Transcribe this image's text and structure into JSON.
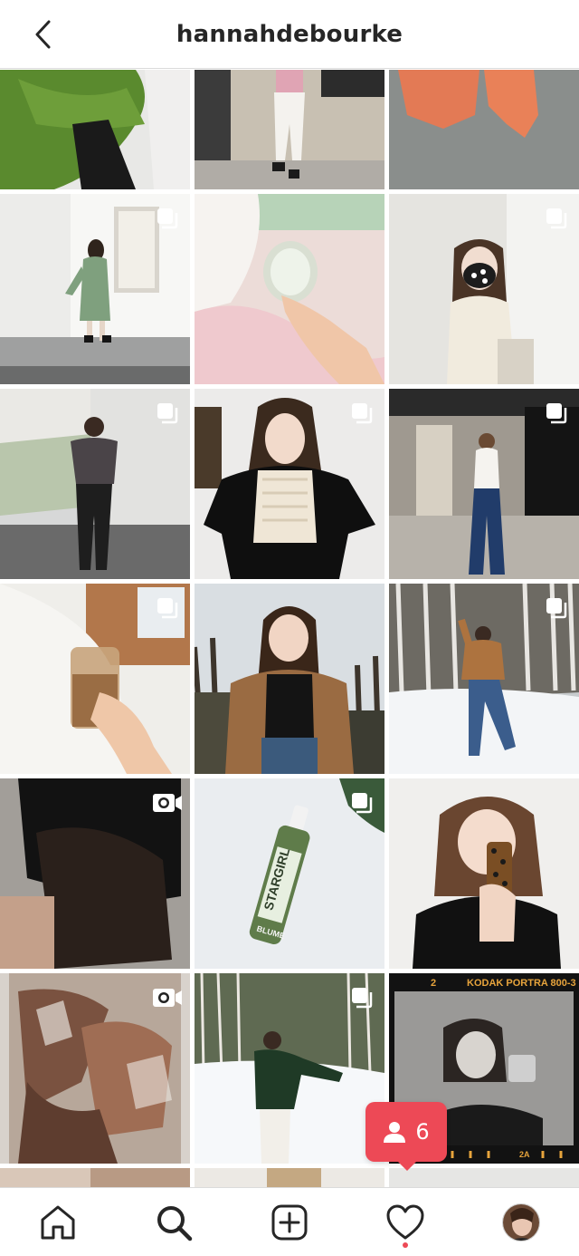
{
  "header": {
    "username": "hannahdebourke"
  },
  "grid": {
    "rows": [
      [
        "green-knit-photo",
        "walking-white-jeans-photo",
        "orange-swimsuits-photo"
      ],
      [
        "green-sweater-dress-photo",
        "jar-on-blanket-photo",
        "face-mask-photo"
      ],
      [
        "leather-pants-photo",
        "white-knit-vest-photo",
        "wide-leg-jeans-photo"
      ],
      [
        "iced-coffee-jar-photo",
        "brown-puffer-photo",
        "snow-kick-photo"
      ],
      [
        "black-top-video",
        "stargirl-bottle-photo",
        "leopard-phone-selfie-photo"
      ],
      [
        "iced-coffee-glass-video",
        "snow-field-green-sweater-photo",
        "kodak-film-photo"
      ]
    ]
  },
  "film_text": {
    "frame_number": "2",
    "brand": "KODAK PORTRA 800-3",
    "frame_mark": "2A"
  },
  "product_text": {
    "brand": "STARGIRL",
    "sub": "BLUME"
  },
  "notification": {
    "follower_count": "6",
    "color": "#ed4956"
  },
  "tabbar": {
    "tabs": [
      "home-icon",
      "search-icon",
      "new-post-icon",
      "activity-icon",
      "profile-avatar"
    ]
  }
}
